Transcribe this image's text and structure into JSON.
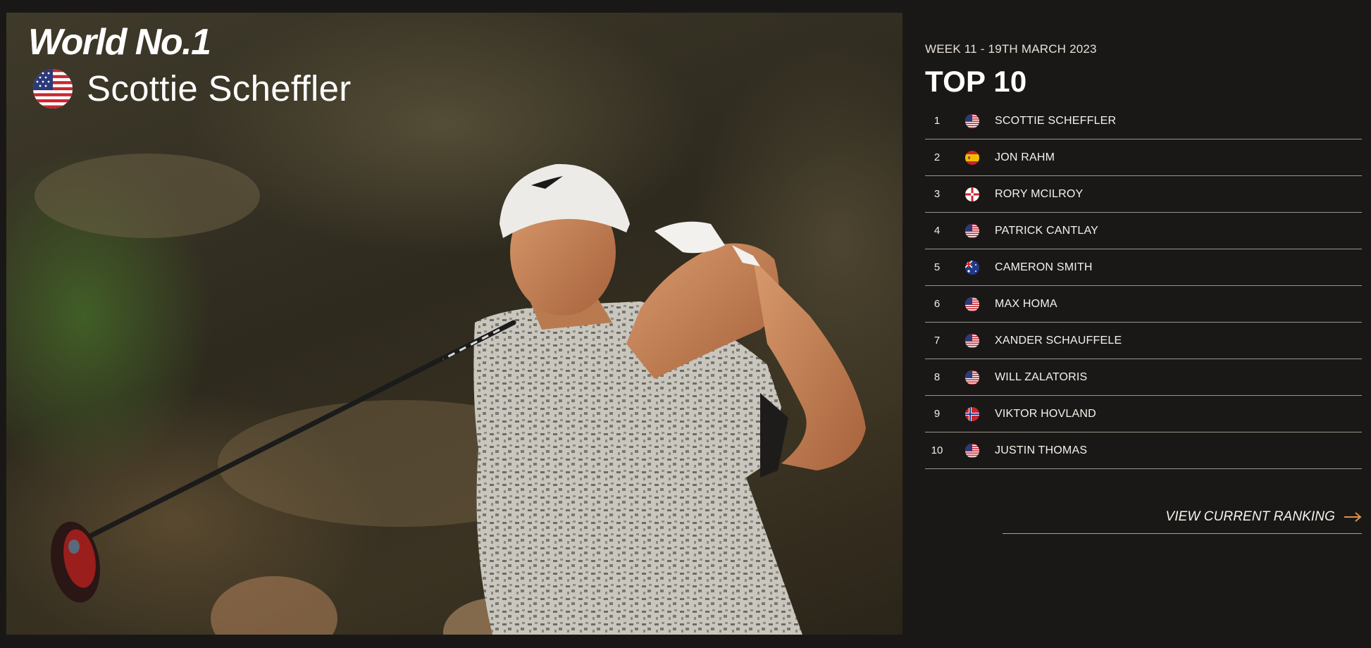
{
  "hero": {
    "title": "World No.1",
    "player_name": "Scottie Scheffler",
    "player_flag_icon": "usa-flag-icon"
  },
  "ranking": {
    "week_label": "WEEK 11 - 19TH MARCH 2023",
    "title": "TOP 10",
    "players": [
      {
        "rank": "1",
        "name": "SCOTTIE SCHEFFLER",
        "flag": "usa"
      },
      {
        "rank": "2",
        "name": "JON RAHM",
        "flag": "spain"
      },
      {
        "rank": "3",
        "name": "RORY MCILROY",
        "flag": "northern-ireland"
      },
      {
        "rank": "4",
        "name": "PATRICK CANTLAY",
        "flag": "usa"
      },
      {
        "rank": "5",
        "name": "CAMERON SMITH",
        "flag": "australia"
      },
      {
        "rank": "6",
        "name": "MAX HOMA",
        "flag": "usa"
      },
      {
        "rank": "7",
        "name": "XANDER SCHAUFFELE",
        "flag": "usa"
      },
      {
        "rank": "8",
        "name": "WILL ZALATORIS",
        "flag": "usa"
      },
      {
        "rank": "9",
        "name": "VIKTOR HOVLAND",
        "flag": "norway"
      },
      {
        "rank": "10",
        "name": "JUSTIN THOMAS",
        "flag": "usa"
      }
    ],
    "view_link_label": "VIEW CURRENT RANKING",
    "view_link_icon": "arrow-right-icon"
  },
  "colors": {
    "background": "#1a1817",
    "accent": "#e0904a",
    "divider": "#9a948a"
  }
}
